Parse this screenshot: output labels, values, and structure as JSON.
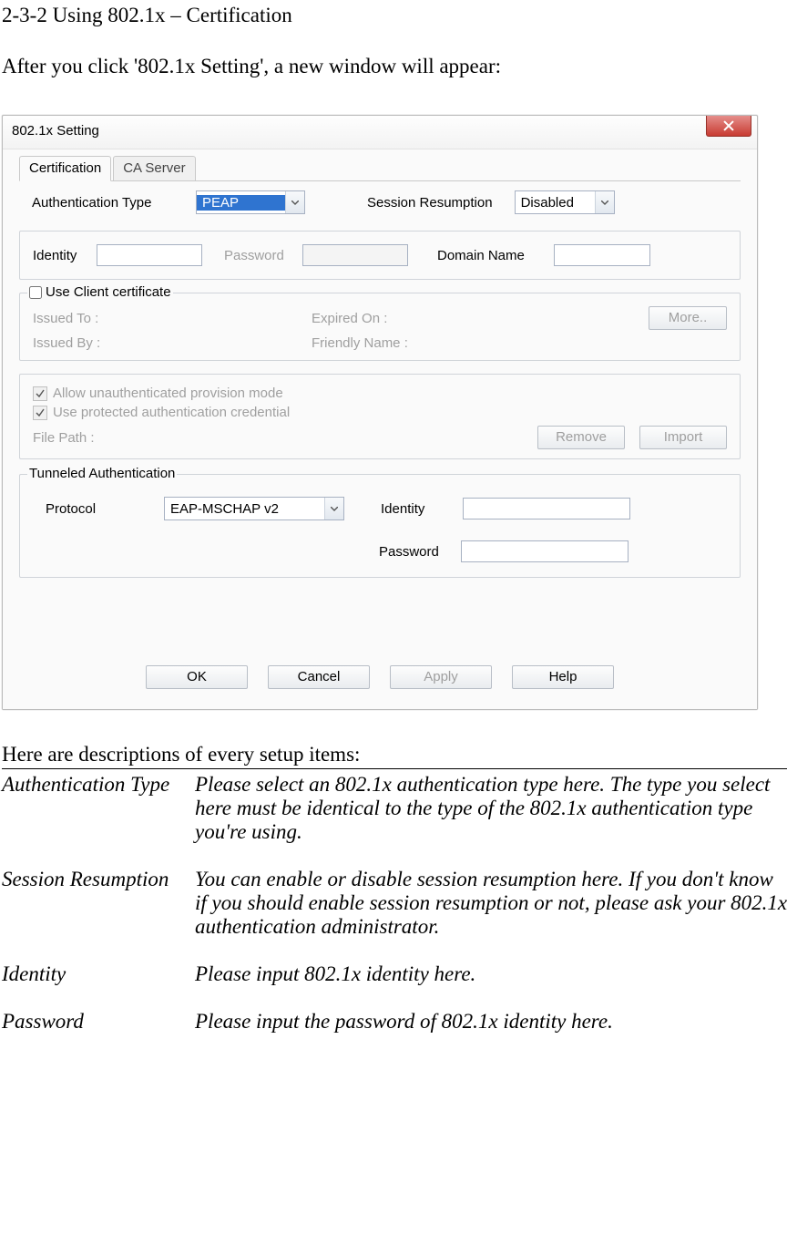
{
  "heading": "2-3-2 Using 802.1x – Certification",
  "intro": "After you click '802.1x Setting', a new window will appear:",
  "followup": "Here are descriptions of every setup items:",
  "descriptions": [
    {
      "label": "Authentication Type",
      "text": "Please select an 802.1x authentication type here. The type you select here must be identical to the type of the 802.1x authentication type you're using."
    },
    {
      "label": "Session Resumption",
      "text": "You can enable or disable session resumption here. If you don't know if you should enable session resumption or not, please ask your 802.1x authentication administrator."
    },
    {
      "label": "Identity",
      "text": "Please input 802.1x identity here."
    },
    {
      "label": "Password",
      "text": "Please input the password of 802.1x identity here."
    }
  ],
  "dialog": {
    "title": "802.1x Setting",
    "tabs": {
      "active": "Certification",
      "inactive": "CA Server"
    },
    "top": {
      "auth_type_label": "Authentication Type",
      "auth_type_value": "PEAP",
      "session_label": "Session Resumption",
      "session_value": "Disabled"
    },
    "idrow": {
      "identity_label": "Identity",
      "identity_value": "",
      "password_label": "Password",
      "password_value": "",
      "domain_label": "Domain Name",
      "domain_value": ""
    },
    "clientcert": {
      "legend": "Use Client certificate",
      "issued_to": "Issued To :",
      "issued_by": "Issued By :",
      "expired_on": "Expired On :",
      "friendly": "Friendly Name :",
      "more": "More.."
    },
    "prov": {
      "allow": "Allow unauthenticated provision mode",
      "usepac": "Use protected authentication credential",
      "file_path_label": "File Path :",
      "remove": "Remove",
      "import": "Import"
    },
    "tunnel": {
      "legend": "Tunneled Authentication",
      "protocol_label": "Protocol",
      "protocol_value": "EAP-MSCHAP v2",
      "identity_label": "Identity",
      "identity_value": "",
      "password_label": "Password",
      "password_value": ""
    },
    "buttons": {
      "ok": "OK",
      "cancel": "Cancel",
      "apply": "Apply",
      "help": "Help"
    }
  }
}
